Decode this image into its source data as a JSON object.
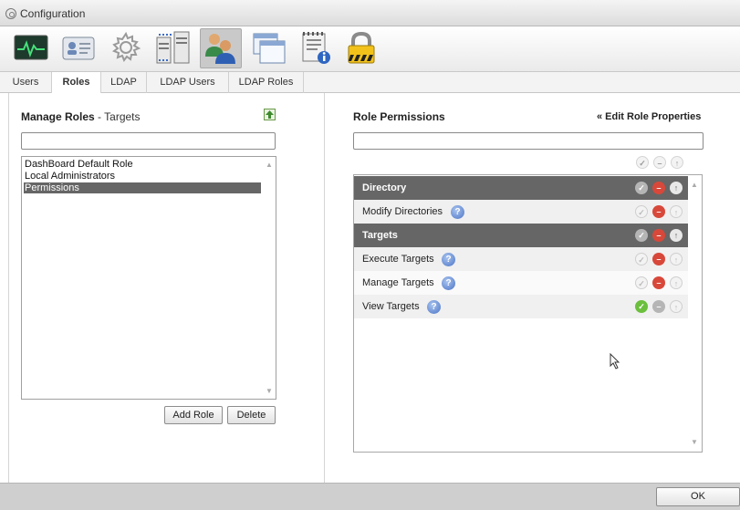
{
  "window": {
    "title": "Configuration"
  },
  "toolbar": {
    "icons": [
      "monitor-icon",
      "user-card-icon",
      "gear-icon",
      "server-icon",
      "users-icon",
      "windows-icon",
      "document-info-icon",
      "lock-icon"
    ],
    "active_index": 4
  },
  "tabs": [
    {
      "label": "Users",
      "active": false
    },
    {
      "label": "Roles",
      "active": true
    },
    {
      "label": "LDAP",
      "active": false
    },
    {
      "label": "LDAP Users",
      "active": false
    },
    {
      "label": "LDAP Roles",
      "active": false
    }
  ],
  "manage_roles": {
    "title": "Manage Roles",
    "subtitle": "- Targets",
    "search_value": "",
    "roles": [
      "DashBoard Default Role",
      "Local Administrators",
      "Permissions"
    ],
    "selected_index": 2,
    "add_label": "Add Role",
    "delete_label": "Delete"
  },
  "role_permissions": {
    "title": "Role Permissions",
    "edit_link": "« Edit Role Properties",
    "search_value": "",
    "rows": [
      {
        "label": "Directory",
        "type": "header"
      },
      {
        "label": "Modify Directories",
        "type": "item",
        "state": "deny"
      },
      {
        "label": "Targets",
        "type": "header"
      },
      {
        "label": "Execute Targets",
        "type": "item",
        "state": "deny"
      },
      {
        "label": "Manage Targets",
        "type": "item",
        "state": "deny"
      },
      {
        "label": "View Targets",
        "type": "item",
        "state": "allow"
      }
    ]
  },
  "footer": {
    "ok_label": "OK"
  },
  "colors": {
    "header_row": "#666666",
    "deny": "#d8483a",
    "allow": "#6bbf3c",
    "help": "#4b74c6"
  }
}
